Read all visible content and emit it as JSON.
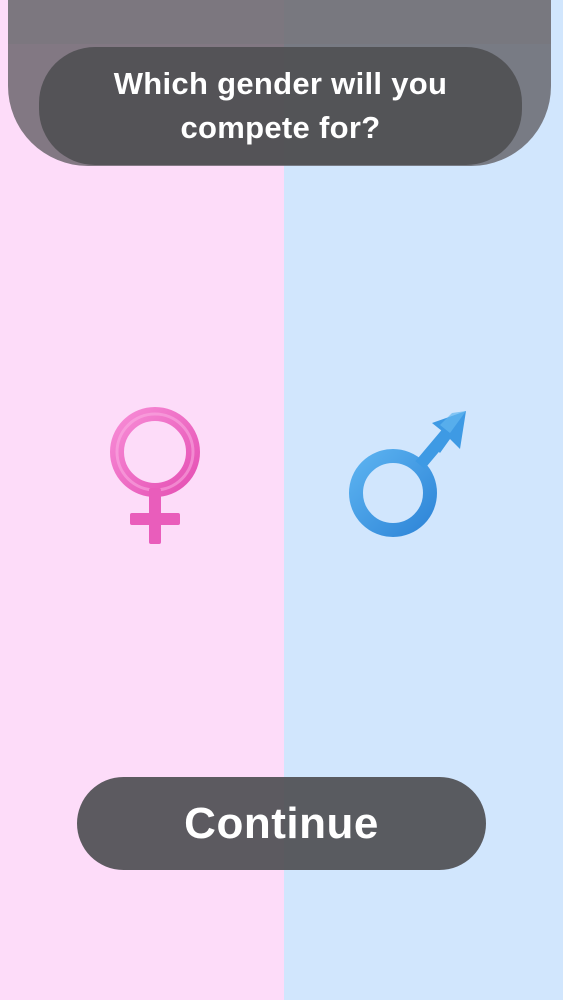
{
  "prompt": {
    "title": "Which gender will you compete for?"
  },
  "options": [
    {
      "id": "female",
      "icon": "female-symbol-icon",
      "background": "#FDDCF9",
      "icon_color": "#F06CC4"
    },
    {
      "id": "male",
      "icon": "male-symbol-icon",
      "background": "#D1E6FD",
      "icon_color": "#3E9AE4"
    }
  ],
  "actions": {
    "continue_label": "Continue"
  },
  "colors": {
    "overlay": "#505054",
    "text": "#FFFFFF"
  }
}
